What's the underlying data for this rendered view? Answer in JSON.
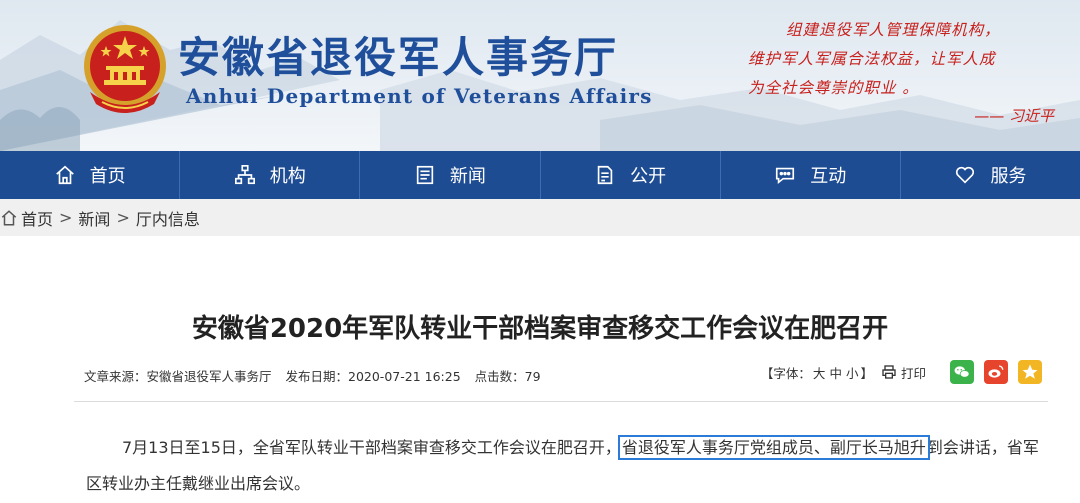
{
  "header": {
    "title": "安徽省退役军人事务厅",
    "subtitle": "Anhui Department of Veterans Affairs",
    "quote_lines": [
      "组建退役军人管理保障机构，",
      "维护军人军属合法权益，让军人成",
      "为全社会尊崇的职业 。"
    ],
    "quote_author": "—— 习近平",
    "emblem_icon": "national-emblem-icon"
  },
  "nav": {
    "items": [
      {
        "label": "首页",
        "icon": "home-icon"
      },
      {
        "label": "机构",
        "icon": "org-icon"
      },
      {
        "label": "新闻",
        "icon": "news-icon"
      },
      {
        "label": "公开",
        "icon": "document-icon"
      },
      {
        "label": "互动",
        "icon": "chat-icon"
      },
      {
        "label": "服务",
        "icon": "heart-icon"
      }
    ]
  },
  "breadcrumb": {
    "home": "首页",
    "sep": ">",
    "news": "新闻",
    "current": "厅内信息"
  },
  "article": {
    "title": "安徽省2020年军队转业干部档案审查移交工作会议在肥召开",
    "source": "文章来源：安徽省退役军人事务厅",
    "date": "发布日期：2020-07-21 16:25",
    "clicks": "点击数：79",
    "font_label_open": "【字体：",
    "font_large": "大",
    "font_medium": "中",
    "font_small": "小",
    "font_label_close": "】",
    "print": "打印",
    "body_before": "7月13日至15日，全省军队转业干部档案审查移交工作会议在肥召开，",
    "body_highlight": "省退役军人事务厅党组成员、副厅长马旭升",
    "body_after": "到会讲话，省军区转业办主任戴继业出席会议。"
  },
  "colors": {
    "nav_bg": "#1e4c93",
    "title_blue": "#1f4f9a",
    "quote_red": "#c8201c",
    "highlight_border": "#2c7bd8"
  }
}
